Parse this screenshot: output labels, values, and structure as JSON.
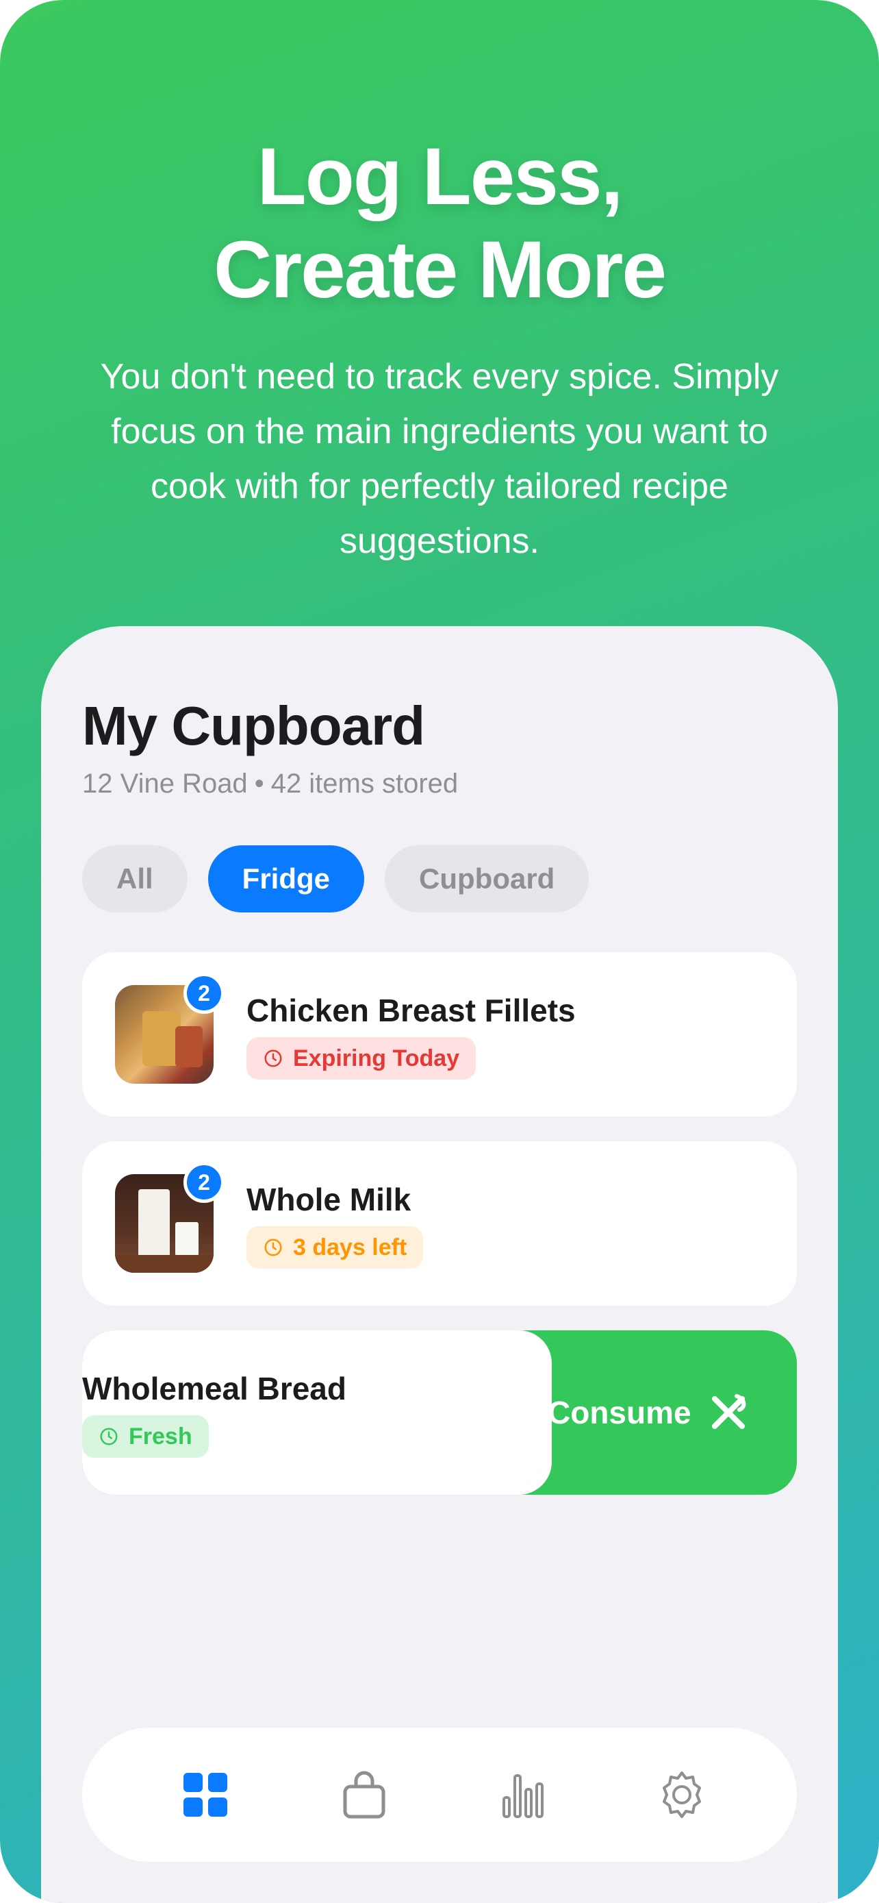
{
  "hero": {
    "title_line1": "Log Less,",
    "title_line2": "Create More",
    "subtitle": "You don't need to track every spice. Simply focus on the main ingredients you want to cook with for perfectly tailored recipe suggestions."
  },
  "cupboard": {
    "title": "My Cupboard",
    "location": "12 Vine Road",
    "separator": "•",
    "item_count": "42 items stored"
  },
  "filters": {
    "all": "All",
    "fridge": "Fridge",
    "cupboard": "Cupboard",
    "selected": "Fridge"
  },
  "items": [
    {
      "name": "Chicken Breast Fillets",
      "count": "2",
      "status": "Expiring Today",
      "status_color": "#e53935"
    },
    {
      "name": "Whole Milk",
      "count": "2",
      "status": "3 days left",
      "status_color": "#ff9500"
    },
    {
      "name": "Wholemeal Bread",
      "status": "Fresh",
      "status_color": "#34c759"
    }
  ],
  "swipe_action": {
    "label": "Consume",
    "icon": "fork-knife-icon",
    "color": "#34c759"
  },
  "tabbar": {
    "icons": [
      "grid-icon",
      "bag-icon",
      "chart-icon",
      "gear-icon"
    ],
    "active": "grid-icon",
    "active_color": "#0a7aff"
  },
  "colors": {
    "accent": "#0a7aff",
    "background_gradient_start": "#3cc95e",
    "background_gradient_end": "#2eb0c9"
  }
}
